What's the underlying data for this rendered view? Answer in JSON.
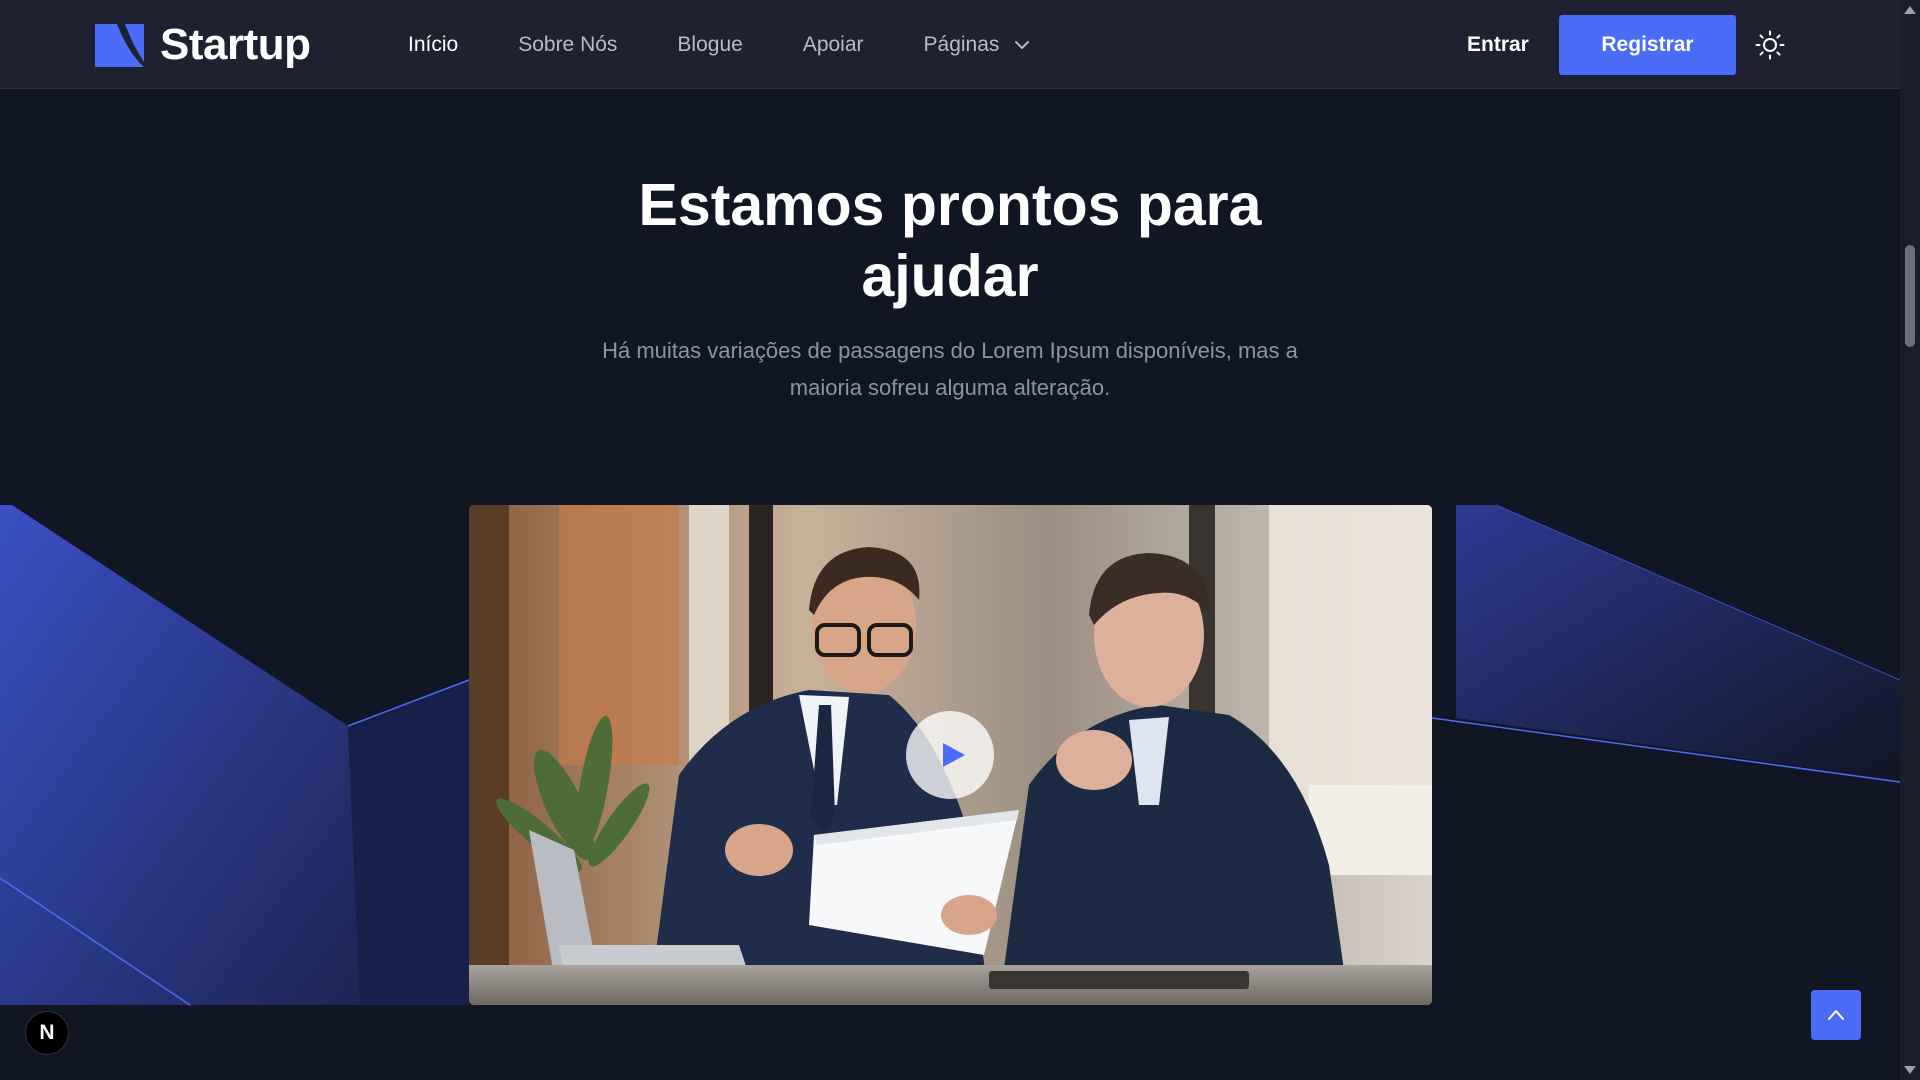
{
  "brand": {
    "name": "Startup",
    "accent_color": "#4a6cf7"
  },
  "nav": {
    "items": [
      {
        "label": "Início",
        "active": true
      },
      {
        "label": "Sobre Nós"
      },
      {
        "label": "Blogue"
      },
      {
        "label": "Apoiar"
      },
      {
        "label": "Páginas",
        "icon": "chevron-down-icon"
      }
    ]
  },
  "header": {
    "signin_label": "Entrar",
    "signup_label": "Registrar",
    "theme_toggle_icon": "sun-icon"
  },
  "section": {
    "title": "Estamos prontos para ajudar",
    "subtitle": "Há muitas variações de passagens do Lorem Ipsum disponíveis, mas a maioria sofreu alguma alteração."
  },
  "video": {
    "play_icon": "play-icon"
  },
  "floating": {
    "next_badge": "N",
    "back_to_top_icon": "chevron-up-icon"
  }
}
